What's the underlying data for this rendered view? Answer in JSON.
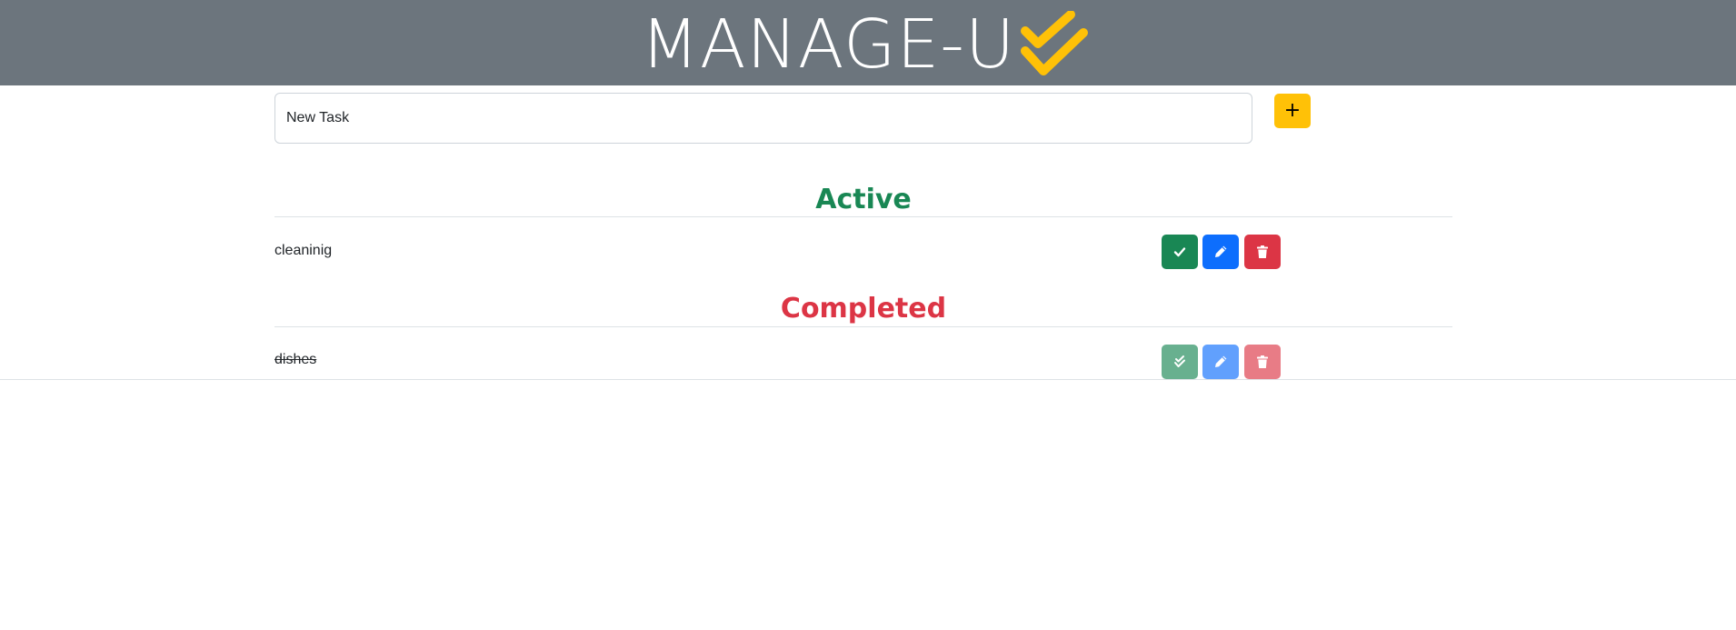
{
  "header": {
    "title": "MANAGE-U",
    "logo_icon": "double-check-icon",
    "background_color": "#6c757d",
    "logo_color": "#ffc107"
  },
  "new_task": {
    "value": "New Task",
    "add_label": "+"
  },
  "active": {
    "heading": "Active",
    "color": "#198754",
    "tasks": [
      {
        "text": "cleaninig",
        "actions": [
          "check-icon",
          "pencil-icon",
          "trash-icon"
        ]
      }
    ]
  },
  "completed": {
    "heading": "Completed",
    "color": "#dc3545",
    "tasks": [
      {
        "text": "dishes",
        "actions": [
          "double-check-icon",
          "pencil-icon",
          "trash-icon"
        ]
      }
    ]
  },
  "colors": {
    "complete": "#198754",
    "edit": "#0d6efd",
    "delete": "#dc3545",
    "add": "#ffc107"
  }
}
